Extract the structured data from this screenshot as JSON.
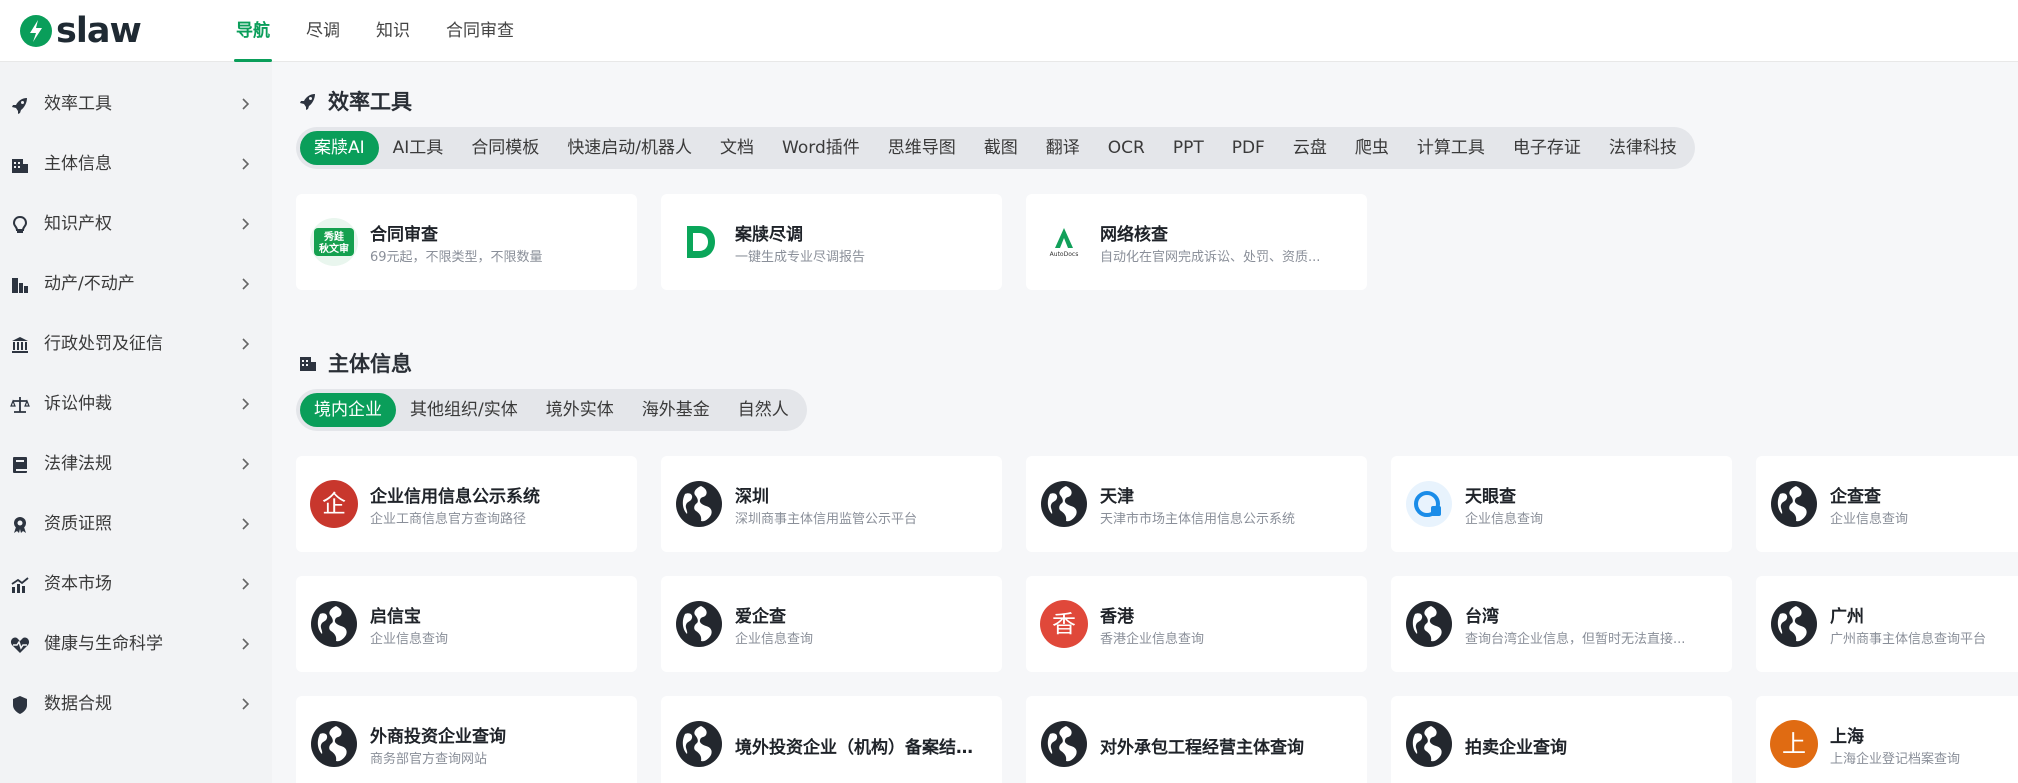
{
  "header": {
    "logo_text": "slaw",
    "tabs": [
      {
        "label": "导航",
        "active": true
      },
      {
        "label": "尽调",
        "active": false
      },
      {
        "label": "知识",
        "active": false
      },
      {
        "label": "合同审查",
        "active": false
      }
    ]
  },
  "sidebar": {
    "items": [
      {
        "label": "效率工具",
        "icon": "rocket-icon"
      },
      {
        "label": "主体信息",
        "icon": "building-icon"
      },
      {
        "label": "知识产权",
        "icon": "lightbulb-icon"
      },
      {
        "label": "动产/不动产",
        "icon": "city-icon"
      },
      {
        "label": "行政处罚及征信",
        "icon": "landmark-icon"
      },
      {
        "label": "诉讼仲裁",
        "icon": "scale-icon"
      },
      {
        "label": "法律法规",
        "icon": "book-icon"
      },
      {
        "label": "资质证照",
        "icon": "award-icon"
      },
      {
        "label": "资本市场",
        "icon": "chart-icon"
      },
      {
        "label": "健康与生命科学",
        "icon": "heart-pulse-icon"
      },
      {
        "label": "数据合规",
        "icon": "shield-icon"
      }
    ]
  },
  "efficiency": {
    "title": "效率工具",
    "tabs": [
      "案牍AI",
      "AI工具",
      "合同模板",
      "快速启动/机器人",
      "文档",
      "Word插件",
      "思维导图",
      "截图",
      "翻译",
      "OCR",
      "PPT",
      "PDF",
      "云盘",
      "爬虫",
      "计算工具",
      "电子存证",
      "法律科技"
    ],
    "active_tab": "案牍AI",
    "cards": [
      {
        "title": "合同审查",
        "desc": "69元起，不限类型，不限数量",
        "icon": "contract-review-logo",
        "icon_text": "秀跬\n秋文审"
      },
      {
        "title": "案牍尽调",
        "desc": "一键生成专业尽调报告",
        "icon": "andu-logo"
      },
      {
        "title": "网络核查",
        "desc": "自动化在官网完成诉讼、处罚、资质...",
        "icon": "autodocs-logo",
        "icon_text": "AutoDocs"
      }
    ]
  },
  "entity": {
    "title": "主体信息",
    "tabs": [
      "境内企业",
      "其他组织/实体",
      "境外实体",
      "海外基金",
      "自然人"
    ],
    "active_tab": "境内企业",
    "cards": [
      {
        "title": "企业信用信息公示系统",
        "desc": "企业工商信息官方查询路径",
        "icon": "char",
        "char": "企",
        "color": "#c8372d"
      },
      {
        "title": "深圳",
        "desc": "深圳商事主体信用监管公示平台",
        "icon": "globe-icon"
      },
      {
        "title": "天津",
        "desc": "天津市市场主体信用信息公示系统",
        "icon": "globe-icon"
      },
      {
        "title": "天眼查",
        "desc": "企业信息查询",
        "icon": "tianyancha-logo"
      },
      {
        "title": "企查查",
        "desc": "企业信息查询",
        "icon": "globe-icon"
      },
      {
        "title": "启信宝",
        "desc": "企业信息查询",
        "icon": "globe-icon"
      },
      {
        "title": "爱企查",
        "desc": "企业信息查询",
        "icon": "globe-icon"
      },
      {
        "title": "香港",
        "desc": "香港企业信息查询",
        "icon": "char",
        "char": "香",
        "color": "#e0483a"
      },
      {
        "title": "台湾",
        "desc": "查询台湾企业信息，但暂时无法直接...",
        "icon": "globe-icon"
      },
      {
        "title": "广州",
        "desc": "广州商事主体信息查询平台",
        "icon": "globe-icon"
      },
      {
        "title": "外商投资企业查询",
        "desc": "商务部官方查询网站",
        "icon": "globe-icon"
      },
      {
        "title": "境外投资企业（机构）备案结果...",
        "desc": "",
        "icon": "globe-icon"
      },
      {
        "title": "对外承包工程经营主体查询",
        "desc": "",
        "icon": "globe-icon"
      },
      {
        "title": "拍卖企业查询",
        "desc": "",
        "icon": "globe-icon"
      },
      {
        "title": "上海",
        "desc": "上海企业登记档案查询",
        "icon": "char",
        "char": "上",
        "color": "#e06b12"
      }
    ]
  },
  "colors": {
    "accent": "#0a9e5a",
    "sidebar_bg": "#f2f3f5",
    "main_bg": "#f6f7f9"
  }
}
